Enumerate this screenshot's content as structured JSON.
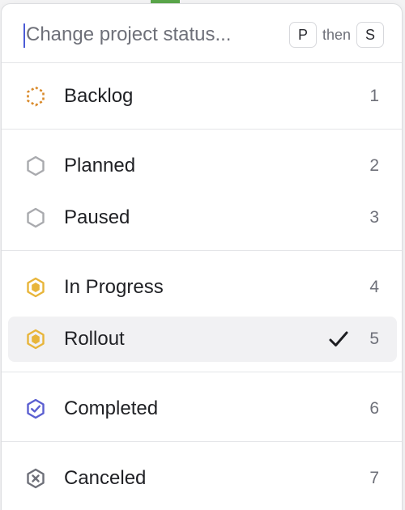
{
  "search": {
    "placeholder": "Change project status...",
    "value": ""
  },
  "shortcut": {
    "key1": "P",
    "then": "then",
    "key2": "S"
  },
  "statuses": [
    {
      "label": "Backlog",
      "shortcut": "1",
      "icon": "backlog-dashed-hexagon-icon",
      "color": "#d98a2b"
    },
    {
      "label": "Planned",
      "shortcut": "2",
      "icon": "planned-hexagon-icon",
      "color": "#a9aaae"
    },
    {
      "label": "Paused",
      "shortcut": "3",
      "icon": "paused-hexagon-icon",
      "color": "#a9aaae"
    },
    {
      "label": "In Progress",
      "shortcut": "4",
      "icon": "in-progress-hexagon-icon",
      "color": "#e8b53a"
    },
    {
      "label": "Rollout",
      "shortcut": "5",
      "icon": "rollout-hexagon-icon",
      "color": "#e8b53a",
      "selected": true
    },
    {
      "label": "Completed",
      "shortcut": "6",
      "icon": "completed-check-hexagon-icon",
      "color": "#5b5fd1"
    },
    {
      "label": "Canceled",
      "shortcut": "7",
      "icon": "canceled-x-hexagon-icon",
      "color": "#6e7079"
    }
  ]
}
